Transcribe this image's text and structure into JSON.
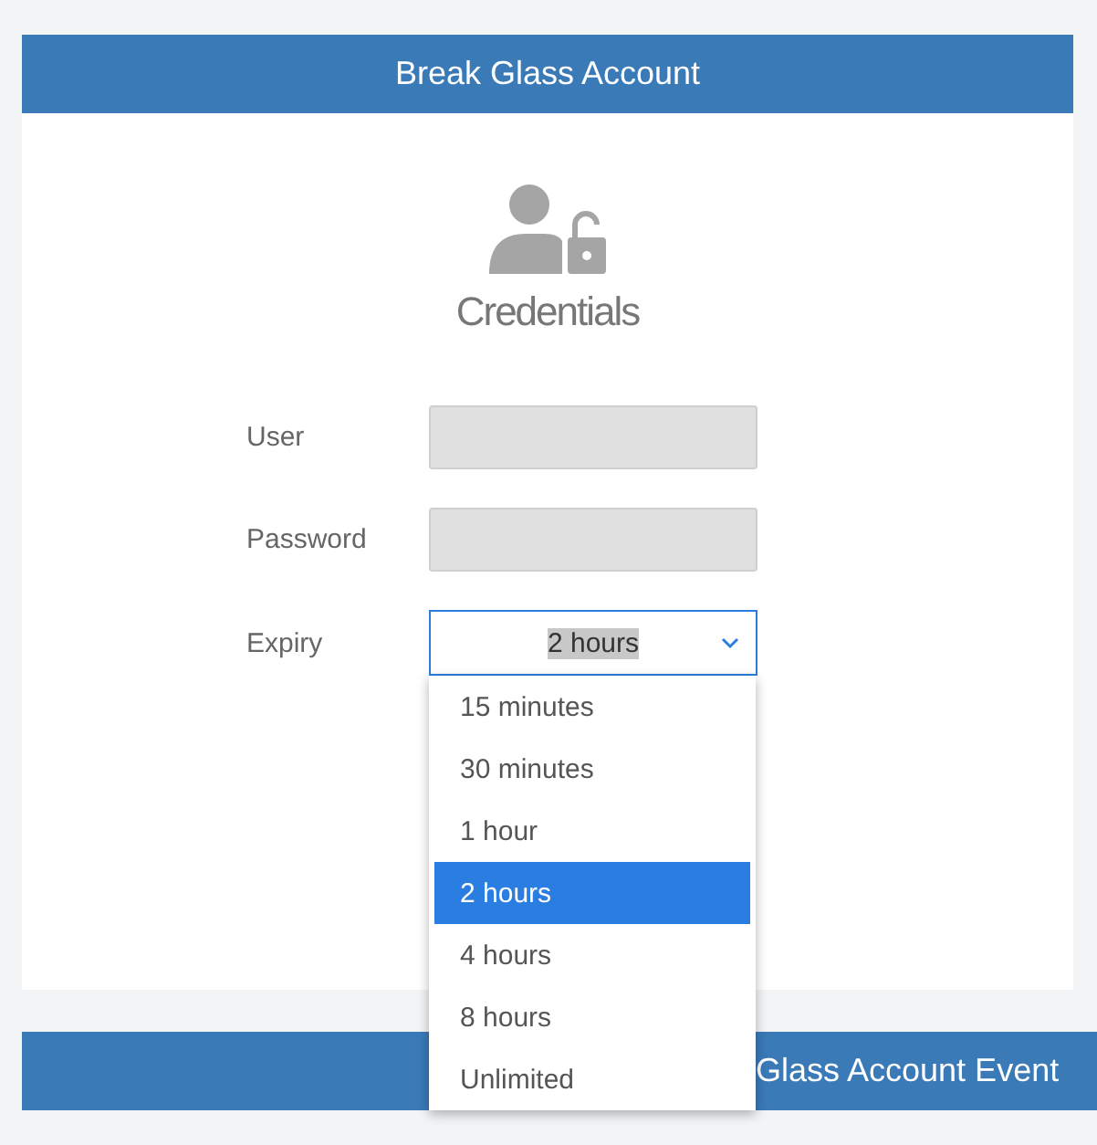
{
  "header": {
    "title": "Break Glass Account"
  },
  "section": {
    "title": "Credentials"
  },
  "fields": [
    {
      "label": "User",
      "kind": "input"
    },
    {
      "label": "Password",
      "kind": "input"
    },
    {
      "label": "Expiry",
      "kind": "select",
      "value": "2 hours",
      "expanded": true,
      "options": [
        {
          "label": "15 minutes",
          "selected": false
        },
        {
          "label": "30 minutes",
          "selected": false
        },
        {
          "label": "1 hour",
          "selected": false
        },
        {
          "label": "2 hours",
          "selected": true
        },
        {
          "label": "4 hours",
          "selected": false
        },
        {
          "label": "8 hours",
          "selected": false
        },
        {
          "label": "Unlimited",
          "selected": false
        }
      ]
    }
  ],
  "next_section": {
    "title": "Glass Account Event"
  }
}
